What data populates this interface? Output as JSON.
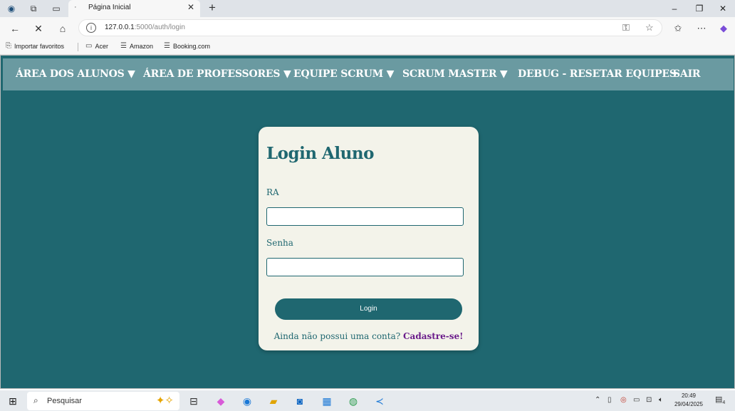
{
  "browser": {
    "tab_title": "Página Inicial",
    "tab_close": "✕",
    "new_tab": "+",
    "window": {
      "minimize": "–",
      "restore": "❐",
      "close": "✕"
    },
    "url_host": "127.0.0.1",
    "url_rest": ":5000/auth/login",
    "favorites": [
      {
        "label": "Importar favoritos"
      },
      {
        "label": "Acer"
      },
      {
        "label": "Amazon"
      },
      {
        "label": "Booking.com"
      }
    ]
  },
  "nav": {
    "items": [
      {
        "label": "ÁREA DOS ALUNOS ▼"
      },
      {
        "label": "ÁREA DE PROFESSORES ▼"
      },
      {
        "label": "EQUIPE SCRUM ▼"
      },
      {
        "label": "SCRUM MASTER ▼"
      },
      {
        "label": "DEBUG - RESETAR EQUIPES"
      },
      {
        "label": "SAIR"
      }
    ]
  },
  "login": {
    "title": "Login Aluno",
    "ra_label": "RA",
    "senha_label": "Senha",
    "ra_value": "",
    "senha_value": "",
    "button": "Login",
    "signup_text": "Ainda não possui uma conta? ",
    "signup_link": "Cadastre-se!"
  },
  "taskbar": {
    "search_placeholder": "Pesquisar",
    "time": "20:49",
    "date": "29/04/2025",
    "notifications": "4"
  },
  "colors": {
    "page_bg": "#1f6770",
    "navbar_bg": "#6a9aa1",
    "card_bg": "#f3f3ea",
    "link": "#6a1b8a"
  }
}
